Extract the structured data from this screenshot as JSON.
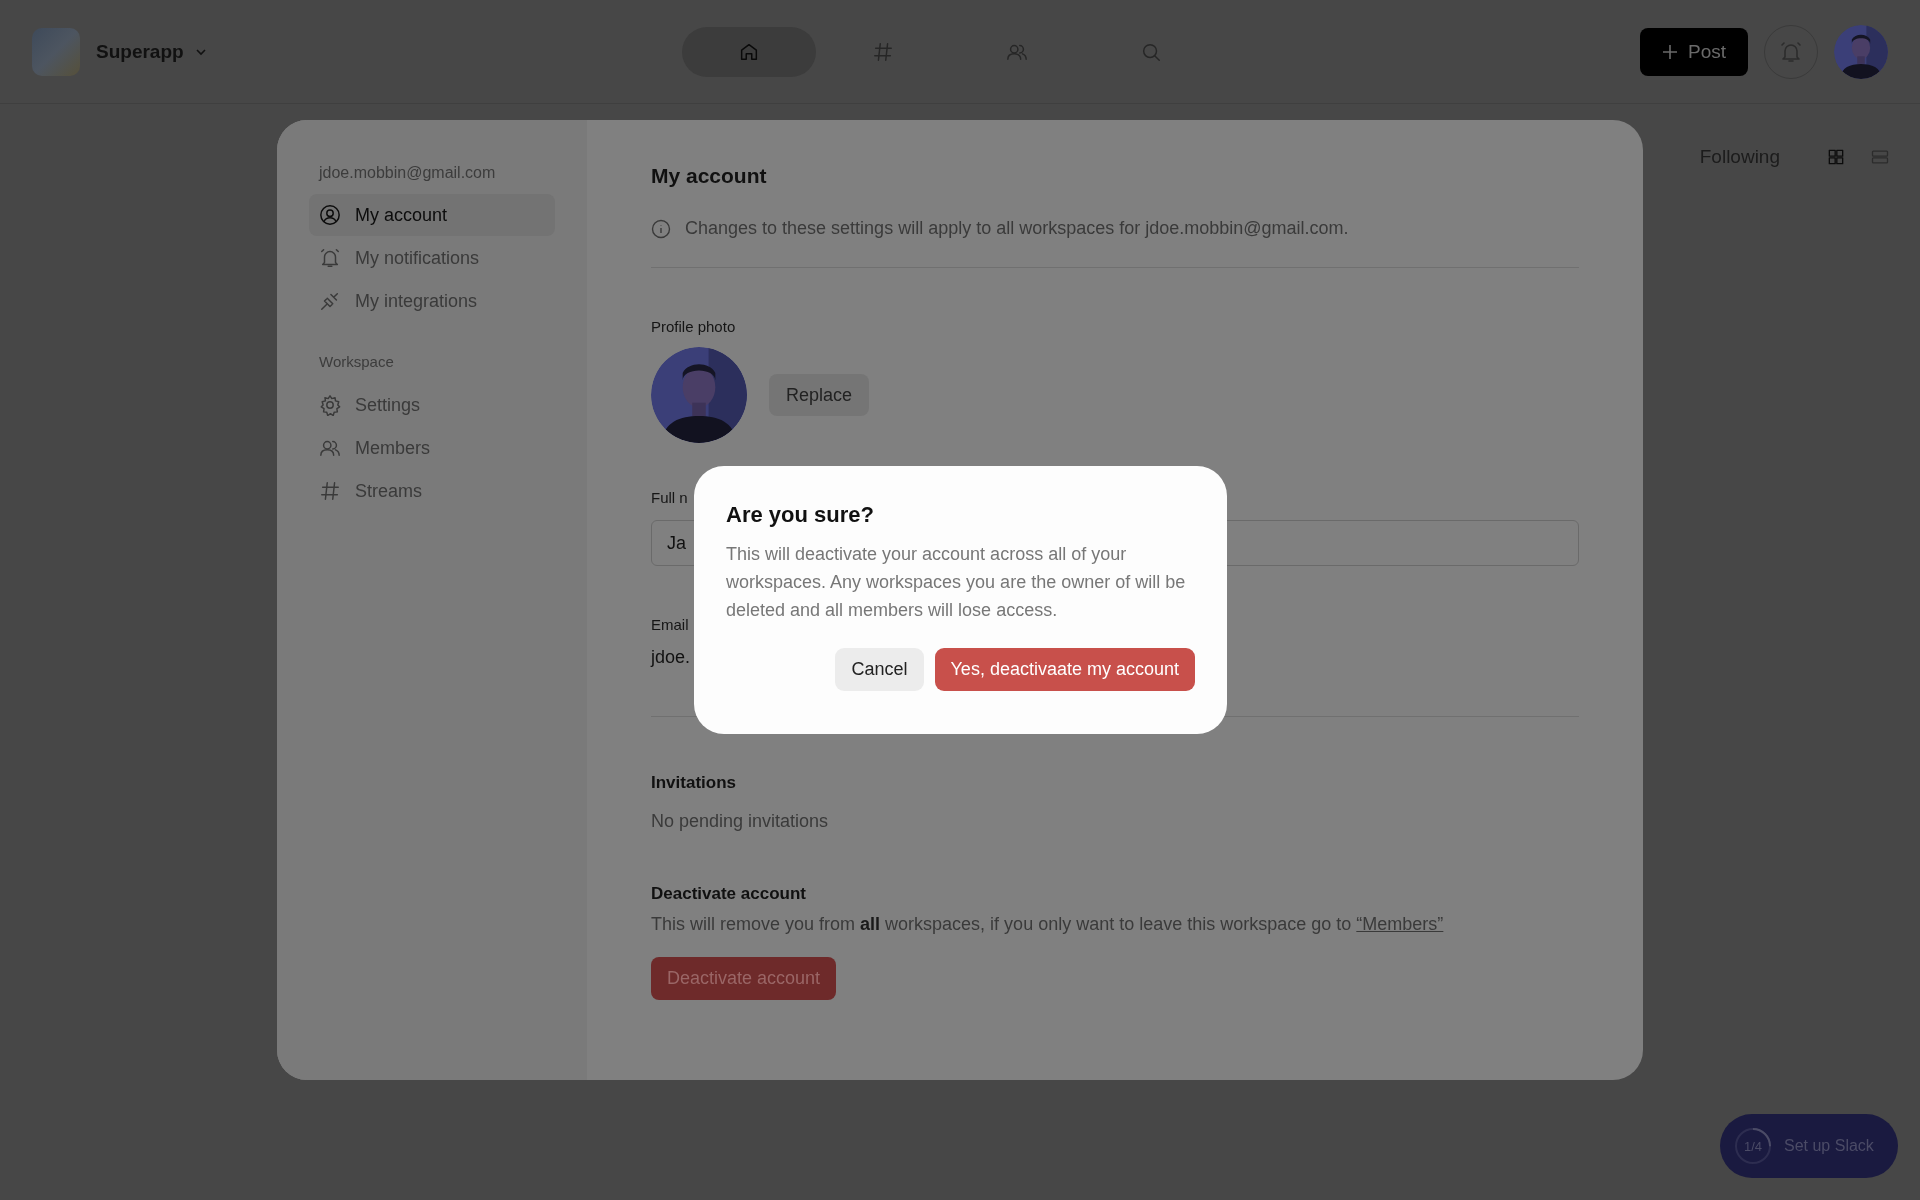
{
  "top_bar": {
    "workspace_name": "Superapp",
    "nav": [
      {
        "kind": "home",
        "selected": true
      },
      {
        "kind": "hash",
        "selected": false
      },
      {
        "kind": "people",
        "selected": false
      },
      {
        "kind": "search",
        "selected": false
      }
    ],
    "post_button": "Post"
  },
  "feed_header": {
    "filter": "Following",
    "views": [
      {
        "kind": "grid",
        "selected": true
      },
      {
        "kind": "list",
        "selected": false
      }
    ]
  },
  "settings": {
    "account_email": "jdoe.mobbin@gmail.com",
    "account_items": [
      {
        "kind": "user",
        "label": "My account",
        "selected": true
      },
      {
        "kind": "bell",
        "label": "My notifications",
        "selected": false
      },
      {
        "kind": "plug",
        "label": "My integrations",
        "selected": false
      }
    ],
    "workspace_heading": "Workspace",
    "workspace_items": [
      {
        "kind": "gear",
        "label": "Settings",
        "selected": false
      },
      {
        "kind": "people",
        "label": "Members",
        "selected": false
      },
      {
        "kind": "hash",
        "label": "Streams",
        "selected": false
      }
    ],
    "title": "My account",
    "info": "Changes to these settings will apply to all workspaces for jdoe.mobbin@gmail.com.",
    "profile_photo_label": "Profile photo",
    "replace_button": "Replace",
    "full_name_label": "Full n",
    "full_name_value": "Ja",
    "email_label": "Email",
    "email_value": "jdoe.",
    "invitations_heading": "Invitations",
    "invitations_text": "No pending invitations",
    "deactivate_heading": "Deactivate account",
    "deactivate_text": "This will remove you from **all** workspaces, if you only want to leave this workspace go to",
    "deactivate_link": "“Members”",
    "deactivate_button": "Deactivate account"
  },
  "dialog": {
    "title": "Are you sure?",
    "message": "This will deactivate your account across all of your workspaces. Any workspaces you are the owner of will be deleted and all members will lose access.",
    "cancel_button": "Cancel",
    "confirm_button": "Yes, deactivaate my account"
  },
  "setup_badge": {
    "progress": "1/4",
    "label": "Set up Slack",
    "level": 0.25
  }
}
